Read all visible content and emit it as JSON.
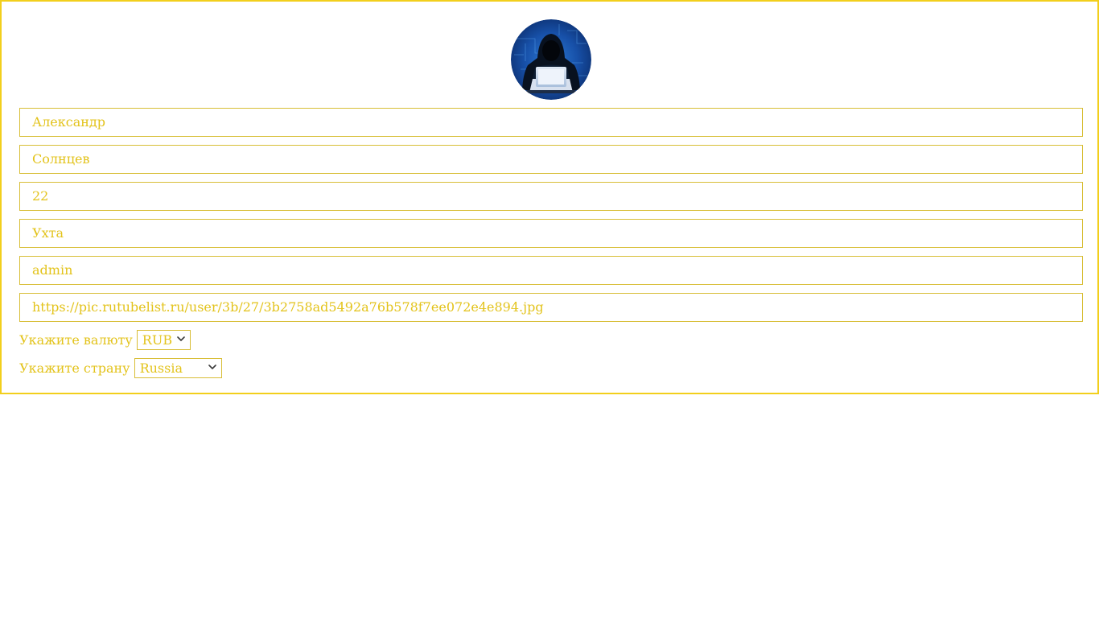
{
  "profile": {
    "avatar_icon": "hacker-avatar-icon",
    "first_name": "Александр",
    "last_name": "Солнцев",
    "age": "22",
    "city": "Ухта",
    "role": "admin",
    "avatar_url": "https://pic.rutubelist.ru/user/3b/27/3b2758ad5492a76b578f7ee072e4e894.jpg"
  },
  "currency": {
    "label": "Укажите валюту",
    "selected": "RUB"
  },
  "country": {
    "label": "Укажите страну",
    "selected": "Russia"
  },
  "colors": {
    "accent_border": "#f2cf1c",
    "field_text": "#e3c31b"
  }
}
